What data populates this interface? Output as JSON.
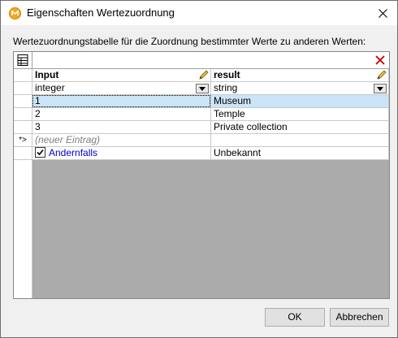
{
  "window": {
    "title": "Eigenschaften Wertezuordnung"
  },
  "description": "Wertezuordnungstabelle für die Zuordnung bestimmter Werte zu anderen Werten:",
  "table": {
    "columns": [
      {
        "header": "Input",
        "type": "integer"
      },
      {
        "header": "result",
        "type": "string"
      }
    ],
    "rows": [
      {
        "input": "1",
        "result": "Museum"
      },
      {
        "input": "2",
        "result": "Temple"
      },
      {
        "input": "3",
        "result": "Private collection"
      }
    ],
    "new_entry_marker": "*>",
    "new_entry_placeholder": "(neuer Eintrag)",
    "otherwise": {
      "label": "Andernfalls",
      "checked": true,
      "result": "Unbekannt"
    }
  },
  "buttons": {
    "ok": "OK",
    "cancel": "Abbrechen"
  },
  "icons": {
    "app": "mapforce-icon",
    "close": "close-icon",
    "table_options": "table-options-icon",
    "delete": "delete-icon",
    "edit": "pencil-icon",
    "dropdown": "dropdown-arrow-icon"
  },
  "colors": {
    "selection": "#cce4f7",
    "link": "#0000cc",
    "delete_icon": "#c00000",
    "app_icon": "#f5a623"
  }
}
